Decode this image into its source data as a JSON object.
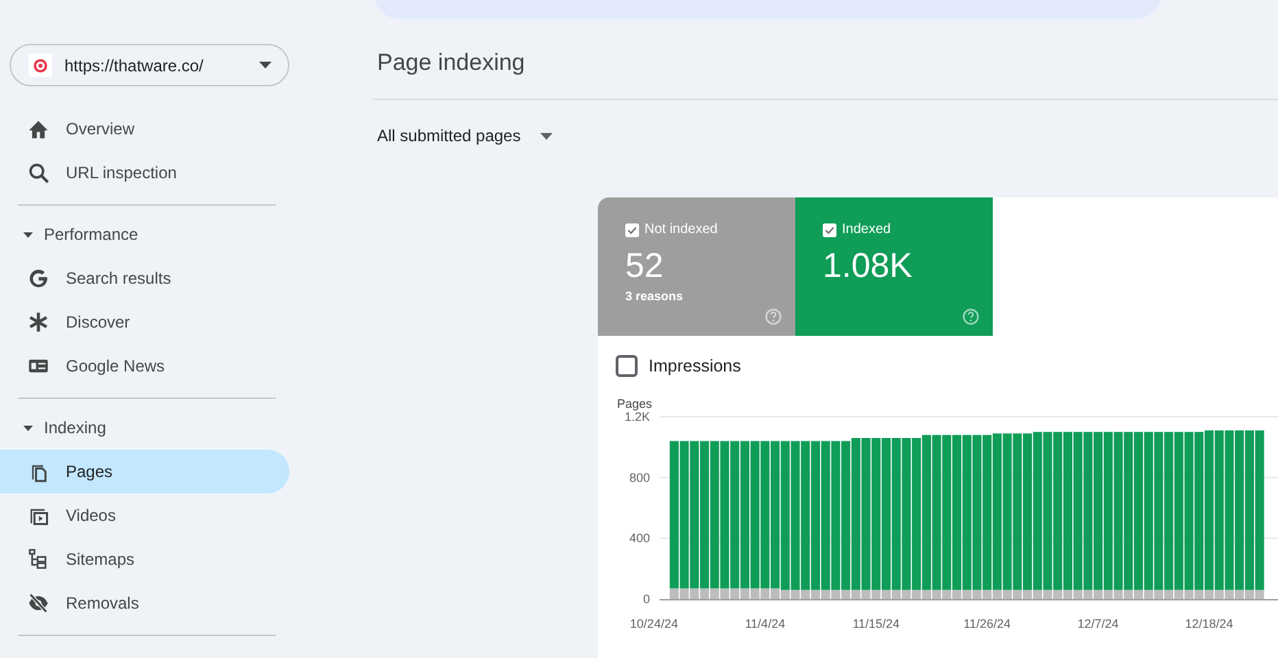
{
  "property_selector": {
    "url": "https://thatware.co/"
  },
  "sidebar": {
    "items": [
      {
        "label": "Overview",
        "selected": false
      },
      {
        "label": "URL inspection",
        "selected": false
      }
    ],
    "sections": [
      {
        "label": "Performance",
        "expanded": true,
        "items": [
          {
            "label": "Search results",
            "selected": false
          },
          {
            "label": "Discover",
            "selected": false
          },
          {
            "label": "Google News",
            "selected": false
          }
        ]
      },
      {
        "label": "Indexing",
        "expanded": true,
        "items": [
          {
            "label": "Pages",
            "selected": true
          },
          {
            "label": "Videos",
            "selected": false
          },
          {
            "label": "Sitemaps",
            "selected": false
          },
          {
            "label": "Removals",
            "selected": false
          }
        ]
      }
    ]
  },
  "page": {
    "title": "Page indexing",
    "filter": "All submitted pages"
  },
  "summary_tiles": [
    {
      "label": "Not indexed",
      "value": "52",
      "detail": "3 reasons",
      "checked": true,
      "color": "#9e9e9e"
    },
    {
      "label": "Indexed",
      "value": "1.08K",
      "checked": true,
      "color": "#0f9d58"
    }
  ],
  "impressions": {
    "label": "Impressions",
    "checked": false
  },
  "chart": {
    "chart_data": {
      "type": "bar",
      "ylabel": "Pages",
      "stacked": true,
      "categories": [
        "10/24/24",
        null,
        null,
        null,
        null,
        null,
        null,
        null,
        null,
        null,
        null,
        "11/4/24",
        null,
        null,
        null,
        null,
        null,
        null,
        null,
        null,
        null,
        null,
        "11/15/24",
        null,
        null,
        null,
        null,
        null,
        null,
        null,
        null,
        null,
        null,
        "11/26/24",
        null,
        null,
        null,
        null,
        null,
        null,
        null,
        null,
        null,
        null,
        "12/7/24",
        null,
        null,
        null,
        null,
        null,
        null,
        null,
        null,
        null,
        null,
        "12/18/24",
        null,
        null,
        null,
        null,
        null
      ],
      "series": [
        {
          "color": "#bdbdbd",
          "values": [
            null,
            null,
            70,
            70,
            70,
            70,
            70,
            70,
            70,
            70,
            70,
            70,
            70,
            60,
            60,
            60,
            60,
            60,
            60,
            60,
            60,
            60,
            60,
            60,
            60,
            60,
            60,
            60,
            60,
            60,
            60,
            60,
            60,
            60,
            60,
            60,
            60,
            60,
            60,
            60,
            60,
            60,
            60,
            60,
            60,
            60,
            60,
            60,
            60,
            60,
            60,
            60,
            60,
            60,
            60,
            60,
            60,
            60,
            60,
            60,
            60
          ]
        },
        {
          "color": "#0f9d58",
          "values": [
            null,
            null,
            970,
            970,
            970,
            970,
            970,
            970,
            970,
            970,
            970,
            970,
            970,
            980,
            980,
            980,
            980,
            980,
            980,
            980,
            1000,
            1000,
            1000,
            1000,
            1000,
            1000,
            1000,
            1020,
            1020,
            1020,
            1020,
            1020,
            1020,
            1020,
            1030,
            1030,
            1030,
            1030,
            1040,
            1040,
            1040,
            1040,
            1040,
            1040,
            1040,
            1040,
            1040,
            1040,
            1040,
            1040,
            1040,
            1040,
            1040,
            1040,
            1040,
            1050,
            1050,
            1050,
            1050,
            1050,
            1050
          ]
        }
      ],
      "ylim": [
        0,
        1200
      ],
      "yticks": [
        0,
        400,
        800,
        {
          "value": 1200,
          "label": "1.2K"
        }
      ]
    }
  }
}
